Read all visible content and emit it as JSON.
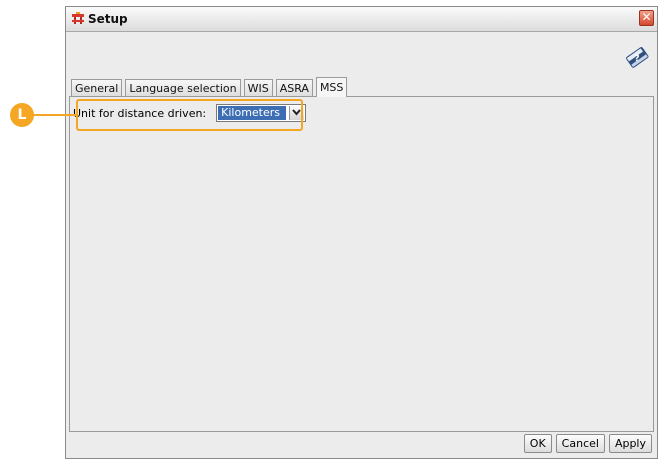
{
  "window": {
    "title": "Setup",
    "close_glyph": "✕"
  },
  "icons": {
    "app": "setup-app-icon",
    "help": "help-book-icon",
    "close": "close-icon",
    "dropdown": "chevron-down-icon"
  },
  "tabs": [
    {
      "label": "General",
      "active": false
    },
    {
      "label": "Language selection",
      "active": false
    },
    {
      "label": "WIS",
      "active": false
    },
    {
      "label": "ASRA",
      "active": false
    },
    {
      "label": "MSS",
      "active": true
    }
  ],
  "mss": {
    "distance_label": "Unit for distance driven:",
    "distance_unit": "Kilometers"
  },
  "buttons": {
    "ok": "OK",
    "cancel": "Cancel",
    "apply": "Apply"
  },
  "callout": {
    "marker": "L"
  },
  "colors": {
    "accent_orange": "#f5a623",
    "selection_blue": "#3d6eb4",
    "close_red": "#d5482c"
  }
}
